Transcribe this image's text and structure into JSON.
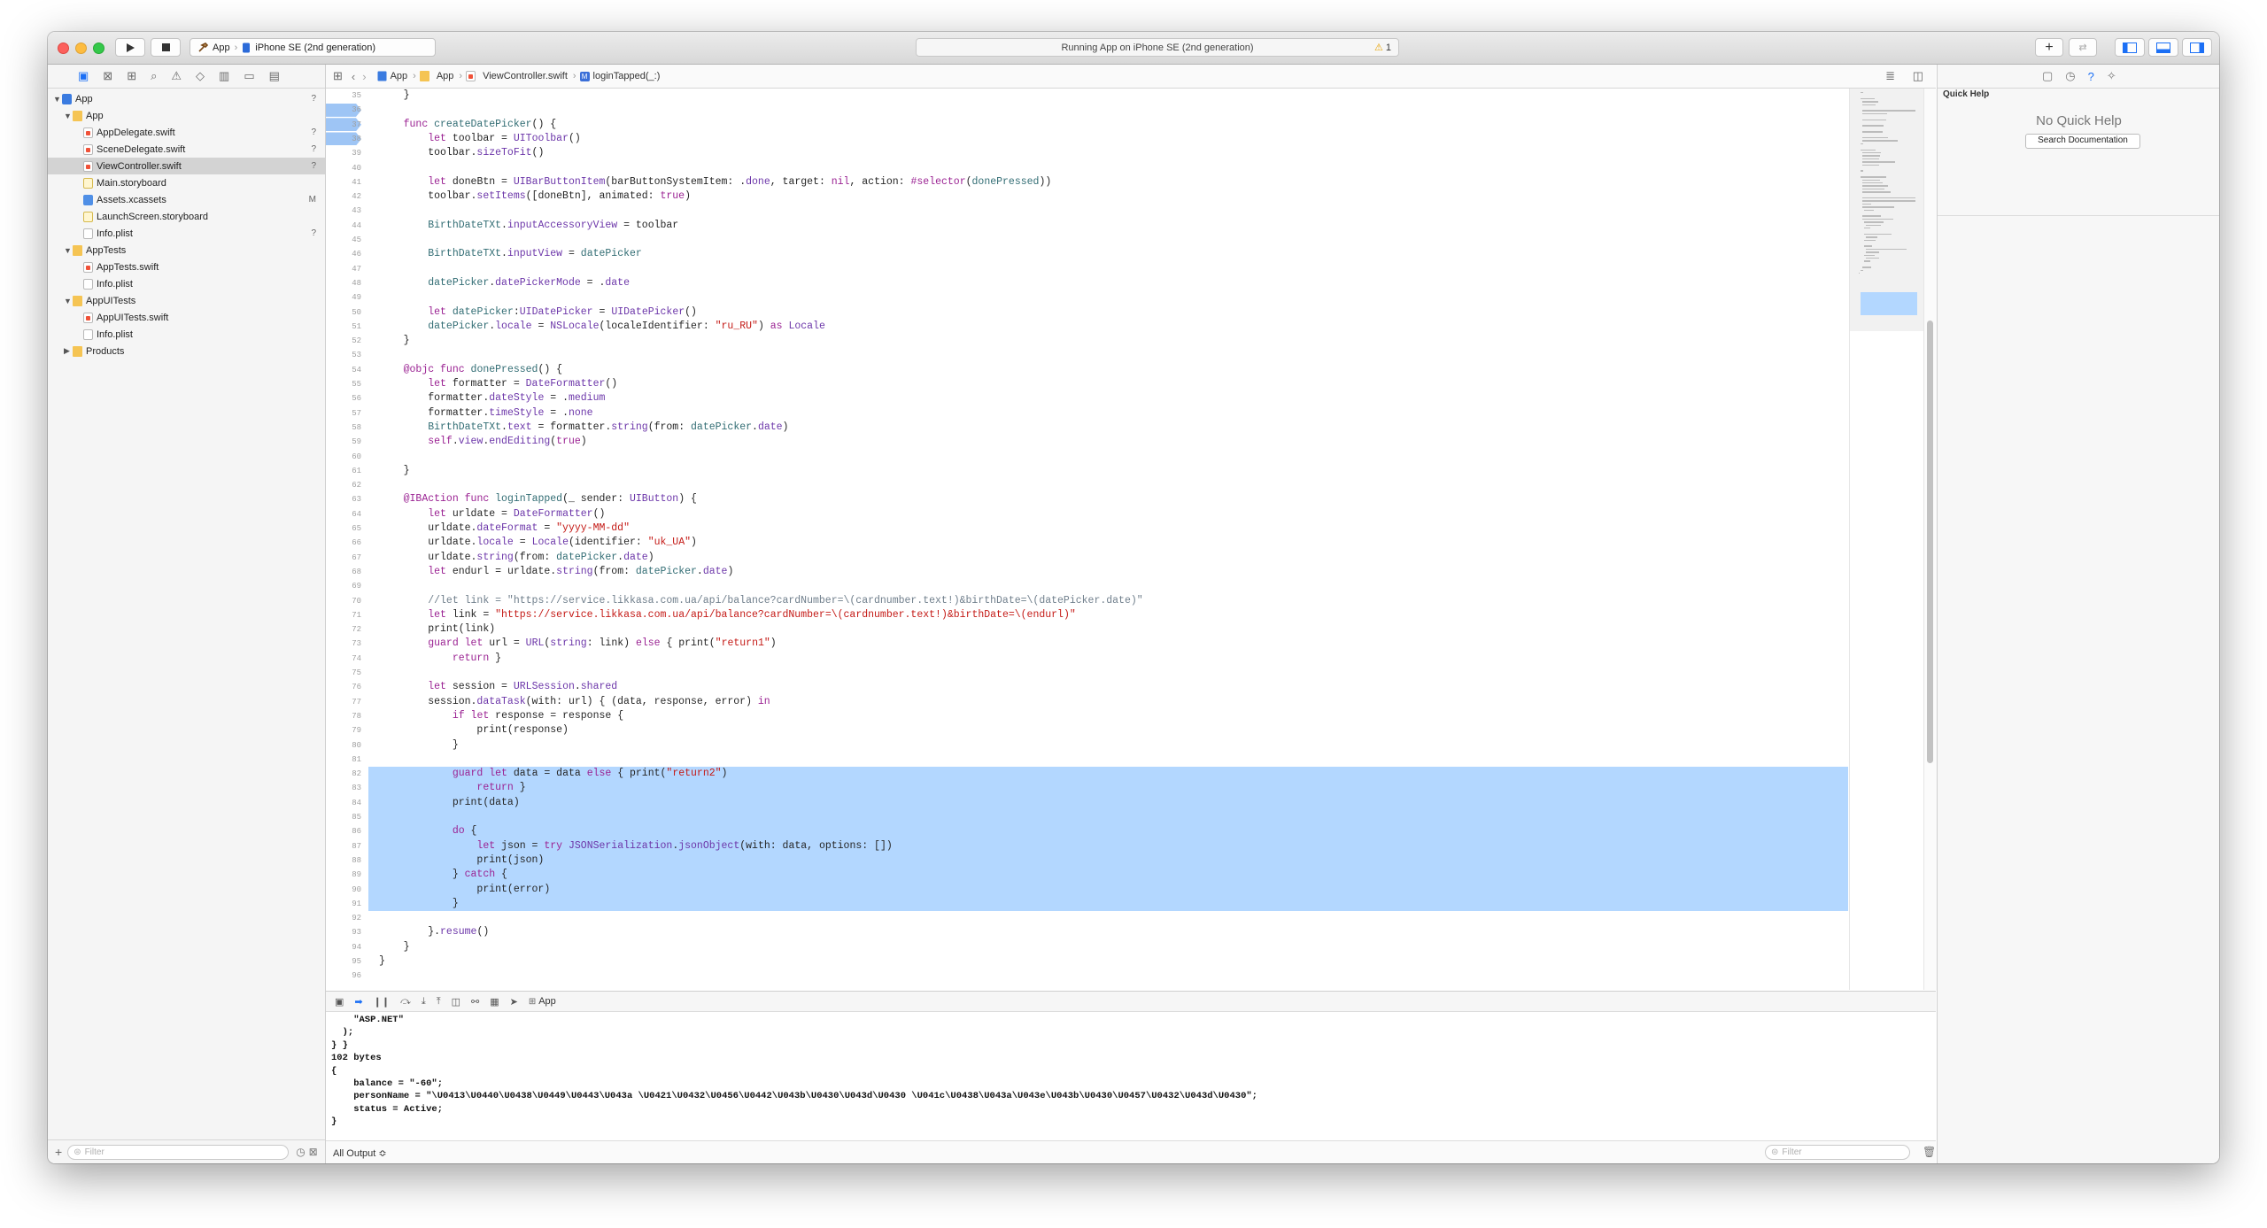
{
  "titlebar": {
    "scheme_target": "App",
    "scheme_device": "iPhone SE (2nd generation)",
    "activity_text": "Running App on iPhone SE (2nd generation)",
    "warning_count": "1",
    "warning_glyph": "⚠"
  },
  "navigator": {
    "filter_placeholder": "Filter",
    "items": [
      {
        "label": "App",
        "level": 0,
        "type": "project",
        "expanded": true,
        "badge": "?"
      },
      {
        "label": "App",
        "level": 1,
        "type": "folder",
        "expanded": true,
        "badge": ""
      },
      {
        "label": "AppDelegate.swift",
        "level": 2,
        "type": "swift",
        "badge": "?"
      },
      {
        "label": "SceneDelegate.swift",
        "level": 2,
        "type": "swift",
        "badge": "?"
      },
      {
        "label": "ViewController.swift",
        "level": 2,
        "type": "swift",
        "badge": "?",
        "selected": true
      },
      {
        "label": "Main.storyboard",
        "level": 2,
        "type": "storyboard",
        "badge": ""
      },
      {
        "label": "Assets.xcassets",
        "level": 2,
        "type": "xcassets",
        "badge": "M"
      },
      {
        "label": "LaunchScreen.storyboard",
        "level": 2,
        "type": "storyboard",
        "badge": ""
      },
      {
        "label": "Info.plist",
        "level": 2,
        "type": "plist",
        "badge": "?"
      },
      {
        "label": "AppTests",
        "level": 1,
        "type": "folder",
        "expanded": true,
        "badge": ""
      },
      {
        "label": "AppTests.swift",
        "level": 2,
        "type": "swift",
        "badge": ""
      },
      {
        "label": "Info.plist",
        "level": 2,
        "type": "plist",
        "badge": ""
      },
      {
        "label": "AppUITests",
        "level": 1,
        "type": "folder",
        "expanded": true,
        "badge": ""
      },
      {
        "label": "AppUITests.swift",
        "level": 2,
        "type": "swift",
        "badge": ""
      },
      {
        "label": "Info.plist",
        "level": 2,
        "type": "plist",
        "badge": ""
      },
      {
        "label": "Products",
        "level": 1,
        "type": "folder",
        "expanded": false,
        "badge": ""
      }
    ]
  },
  "jumpbar": {
    "crumbs": [
      "App",
      "App",
      "ViewController.swift",
      "loginTapped(_:)"
    ]
  },
  "editor": {
    "lines": [
      {
        "n": "35",
        "t": "    }"
      },
      {
        "n": "36",
        "t": ""
      },
      {
        "n": "37",
        "t": "    func createDatePicker() {"
      },
      {
        "n": "38",
        "t": "        let toolbar = UIToolbar()"
      },
      {
        "n": "39",
        "t": "        toolbar.sizeToFit()"
      },
      {
        "n": "40",
        "t": ""
      },
      {
        "n": "41",
        "t": "        let doneBtn = UIBarButtonItem(barButtonSystemItem: .done, target: nil, action: #selector(donePressed))"
      },
      {
        "n": "42",
        "t": "        toolbar.setItems([doneBtn], animated: true)"
      },
      {
        "n": "43",
        "t": ""
      },
      {
        "n": "44",
        "t": "        BirthDateTXt.inputAccessoryView = toolbar"
      },
      {
        "n": "45",
        "t": ""
      },
      {
        "n": "46",
        "t": "        BirthDateTXt.inputView = datePicker"
      },
      {
        "n": "47",
        "t": ""
      },
      {
        "n": "48",
        "t": "        datePicker.datePickerMode = .date"
      },
      {
        "n": "49",
        "t": ""
      },
      {
        "n": "50",
        "t": "        let datePicker:UIDatePicker = UIDatePicker()"
      },
      {
        "n": "51",
        "t": "        datePicker.locale = NSLocale(localeIdentifier: \"ru_RU\") as Locale"
      },
      {
        "n": "52",
        "t": "    }"
      },
      {
        "n": "53",
        "t": ""
      },
      {
        "n": "54",
        "t": "    @objc func donePressed() {"
      },
      {
        "n": "55",
        "t": "        let formatter = DateFormatter()"
      },
      {
        "n": "56",
        "t": "        formatter.dateStyle = .medium"
      },
      {
        "n": "57",
        "t": "        formatter.timeStyle = .none"
      },
      {
        "n": "58",
        "t": "        BirthDateTXt.text = formatter.string(from: datePicker.date)"
      },
      {
        "n": "59",
        "t": "        self.view.endEditing(true)"
      },
      {
        "n": "60",
        "t": ""
      },
      {
        "n": "61",
        "t": "    }"
      },
      {
        "n": "62",
        "t": ""
      },
      {
        "n": "63",
        "t": "    @IBAction func loginTapped(_ sender: UIButton) {"
      },
      {
        "n": "64",
        "t": "        let urldate = DateFormatter()"
      },
      {
        "n": "65",
        "t": "        urldate.dateFormat = \"yyyy-MM-dd\""
      },
      {
        "n": "66",
        "t": "        urldate.locale = Locale(identifier: \"uk_UA\")"
      },
      {
        "n": "67",
        "t": "        urldate.string(from: datePicker.date)"
      },
      {
        "n": "68",
        "t": "        let endurl = urldate.string(from: datePicker.date)"
      },
      {
        "n": "69",
        "t": ""
      },
      {
        "n": "70",
        "t": "        //let link = \"https://service.likkasa.com.ua/api/balance?cardNumber=\\(cardnumber.text!)&birthDate=\\(datePicker.date)\""
      },
      {
        "n": "71",
        "t": "        let link = \"https://service.likkasa.com.ua/api/balance?cardNumber=\\(cardnumber.text!)&birthDate=\\(endurl)\""
      },
      {
        "n": "72",
        "t": "        print(link)"
      },
      {
        "n": "73",
        "t": "        guard let url = URL(string: link) else { print(\"return1\")"
      },
      {
        "n": "74",
        "t": "            return }"
      },
      {
        "n": "75",
        "t": ""
      },
      {
        "n": "76",
        "t": "        let session = URLSession.shared"
      },
      {
        "n": "77",
        "t": "        session.dataTask(with: url) { (data, response, error) in"
      },
      {
        "n": "78",
        "t": "            if let response = response {"
      },
      {
        "n": "79",
        "t": "                print(response)"
      },
      {
        "n": "80",
        "t": "            }"
      },
      {
        "n": "81",
        "t": ""
      },
      {
        "n": "82",
        "t": "            guard let data = data else { print(\"return2\")"
      },
      {
        "n": "83",
        "t": "                return }"
      },
      {
        "n": "84",
        "t": "            print(data)"
      },
      {
        "n": "85",
        "t": ""
      },
      {
        "n": "86",
        "t": "            do {"
      },
      {
        "n": "87",
        "t": "                let json = try JSONSerialization.jsonObject(with: data, options: [])"
      },
      {
        "n": "88",
        "t": "                print(json)"
      },
      {
        "n": "89",
        "t": "            } catch {"
      },
      {
        "n": "90",
        "t": "                print(error)"
      },
      {
        "n": "91",
        "t": "            }"
      },
      {
        "n": "92",
        "t": ""
      },
      {
        "n": "93",
        "t": "        }.resume()"
      },
      {
        "n": "94",
        "t": "    }"
      },
      {
        "n": "95",
        "t": "}"
      },
      {
        "n": "96",
        "t": ""
      }
    ],
    "selection_first_line": "82",
    "selection_last_line": "91",
    "breakpoint_lines": [
      "36",
      "37",
      "38"
    ]
  },
  "debug": {
    "process_label": "App",
    "output_selector": "All Output ≎",
    "filter_placeholder": "Filter",
    "console_lines": [
      "    \"ASP.NET\"",
      "  );",
      "} }",
      "102 bytes",
      "{",
      "    balance = \"-60\";",
      "    personName = \"\\U0413\\U0440\\U0438\\U0449\\U0443\\U043a \\U0421\\U0432\\U0456\\U0442\\U043b\\U0430\\U043d\\U0430 \\U041c\\U0438\\U043a\\U043e\\U043b\\U0430\\U0457\\U0432\\U043d\\U0430\";",
      "    status = Active;",
      "}"
    ]
  },
  "inspector": {
    "title": "Quick Help",
    "no_help_text": "No Quick Help",
    "search_button": "Search Documentation"
  },
  "colors": {
    "keyword": "#9b2393",
    "string": "#c41a16",
    "type": "#0b4f79",
    "project_ref": "#326d74",
    "comment": "#707f8c",
    "selection": "#b3d7ff",
    "accent": "#1b6ff5"
  }
}
